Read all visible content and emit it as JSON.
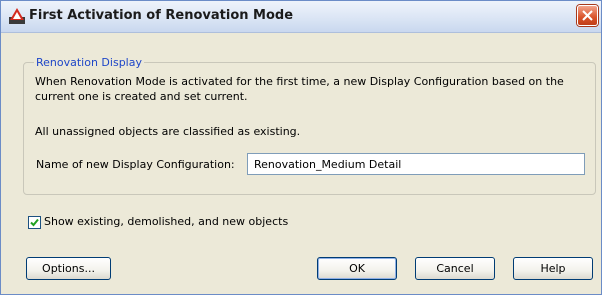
{
  "window": {
    "title": "First Activation of Renovation Mode",
    "icon": "autodesk-app-icon",
    "close_icon": "close-icon"
  },
  "group": {
    "legend": "Renovation Display",
    "description": "When Renovation Mode is activated for the first time, a new Display Configuration based on the current one is created and set current.",
    "note": "All unassigned objects are classified as existing.",
    "field_label": "Name of new Display Configuration:",
    "field_value": "Renovation_Medium Detail"
  },
  "options": {
    "show_objects_label": "Show existing, demolished, and new objects",
    "show_objects_checked": true
  },
  "buttons": {
    "options": "Options...",
    "ok": "OK",
    "cancel": "Cancel",
    "help": "Help"
  },
  "colors": {
    "legend": "#1f47c8",
    "close": "#d9532a",
    "dialog_bg": "#ece9d8"
  }
}
